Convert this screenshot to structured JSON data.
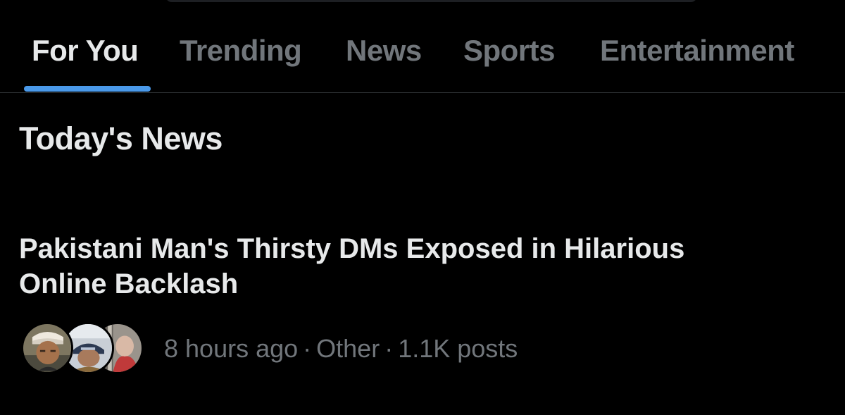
{
  "tabs": [
    {
      "label": "For You",
      "active": true
    },
    {
      "label": "Trending",
      "active": false
    },
    {
      "label": "News",
      "active": false
    },
    {
      "label": "Sports",
      "active": false
    },
    {
      "label": "Entertainment",
      "active": false
    }
  ],
  "section": {
    "title": "Today's News"
  },
  "story": {
    "headline": "Pakistani Man's Thirsty DMs Exposed in Hilarious Online Backlash",
    "time": "8 hours ago",
    "category": "Other",
    "posts": "1.1K posts",
    "avatars": [
      "person-avatar",
      "person-avatar",
      "person-avatar"
    ]
  },
  "colors": {
    "background": "#000000",
    "text_primary": "#e7e9ea",
    "text_secondary": "#71767b",
    "accent": "#4a99e9",
    "divider": "#2f3336"
  }
}
